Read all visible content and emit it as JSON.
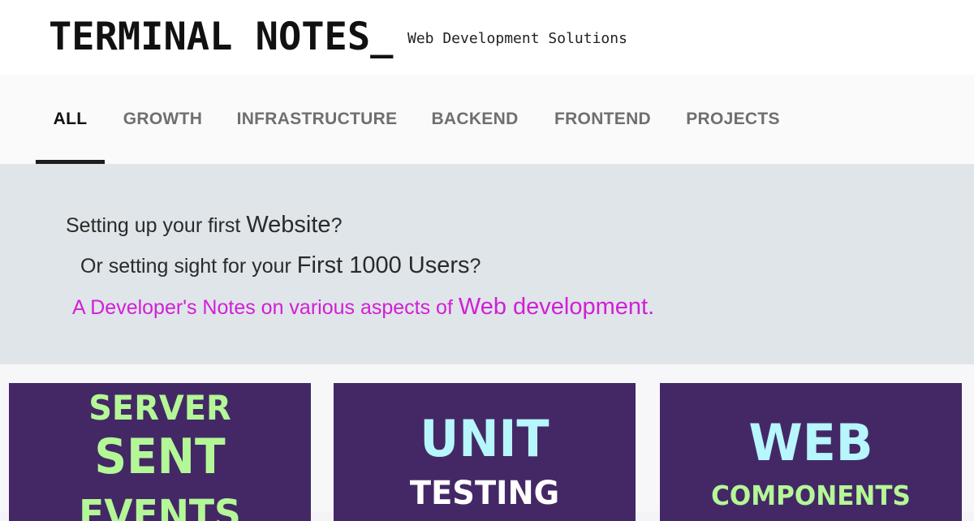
{
  "header": {
    "title": "TERMINAL NOTES_",
    "tagline": "Web Development Solutions"
  },
  "nav": {
    "tabs": [
      {
        "label": "ALL",
        "active": true
      },
      {
        "label": "GROWTH",
        "active": false
      },
      {
        "label": "INFRASTRUCTURE",
        "active": false
      },
      {
        "label": "BACKEND",
        "active": false
      },
      {
        "label": "FRONTEND",
        "active": false
      },
      {
        "label": "PROJECTS",
        "active": false
      }
    ]
  },
  "hero": {
    "line1": {
      "prefix": "Setting up your first ",
      "emphasis": "Website",
      "suffix": "?"
    },
    "line2": {
      "prefix": "Or setting sight for your ",
      "emphasis": "First 1000 Users",
      "suffix": "?"
    },
    "line3": {
      "prefix": "A Developer's Notes on various aspects of ",
      "emphasis": "Web development."
    }
  },
  "cards": [
    {
      "words": [
        "SERVER",
        "SENT",
        "EVENTS"
      ]
    },
    {
      "words": [
        "UNIT",
        "TESTING"
      ]
    },
    {
      "words": [
        "WEB",
        "COMPONENTS"
      ]
    }
  ],
  "colors": {
    "card_background": "#442866",
    "hero_background": "#dfe5e9",
    "hero_accent": "#d21fd6",
    "card_green": "#b4f797",
    "card_cyan": "#b6f6fc"
  }
}
